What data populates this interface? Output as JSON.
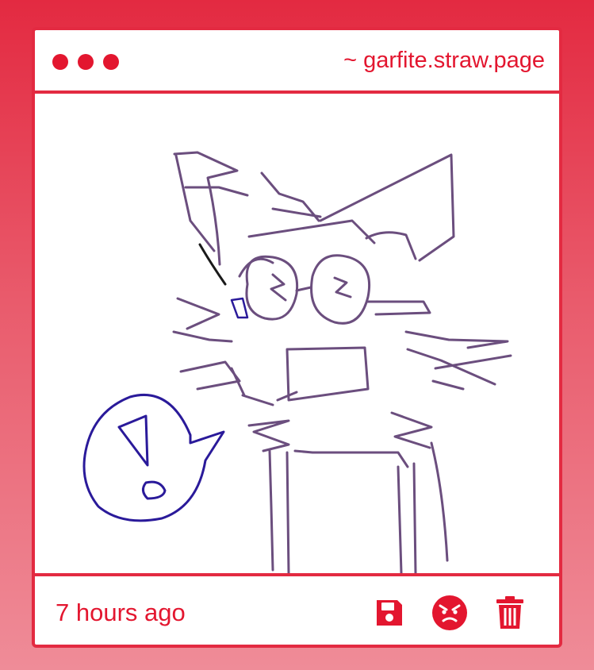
{
  "window": {
    "dots": [
      "dot",
      "dot",
      "dot"
    ],
    "site_label": "~ garfite.straw.page"
  },
  "post": {
    "timestamp": "7 hours ago",
    "drawing_alt": "hand-drawn cat doodle with speech bubble"
  },
  "actions": [
    {
      "name": "save-button",
      "icon": "floppy-disk-icon"
    },
    {
      "name": "angry-reaction-button",
      "icon": "angry-face-icon"
    },
    {
      "name": "delete-button",
      "icon": "trash-icon"
    }
  ],
  "colors": {
    "accent": "#e32a41",
    "icon_red": "#e3162f",
    "doodle_purple": "#6b4e7e",
    "bubble_blue": "#2a1a9a",
    "background_top": "#e32a41",
    "background_bottom": "#ef8c98"
  }
}
